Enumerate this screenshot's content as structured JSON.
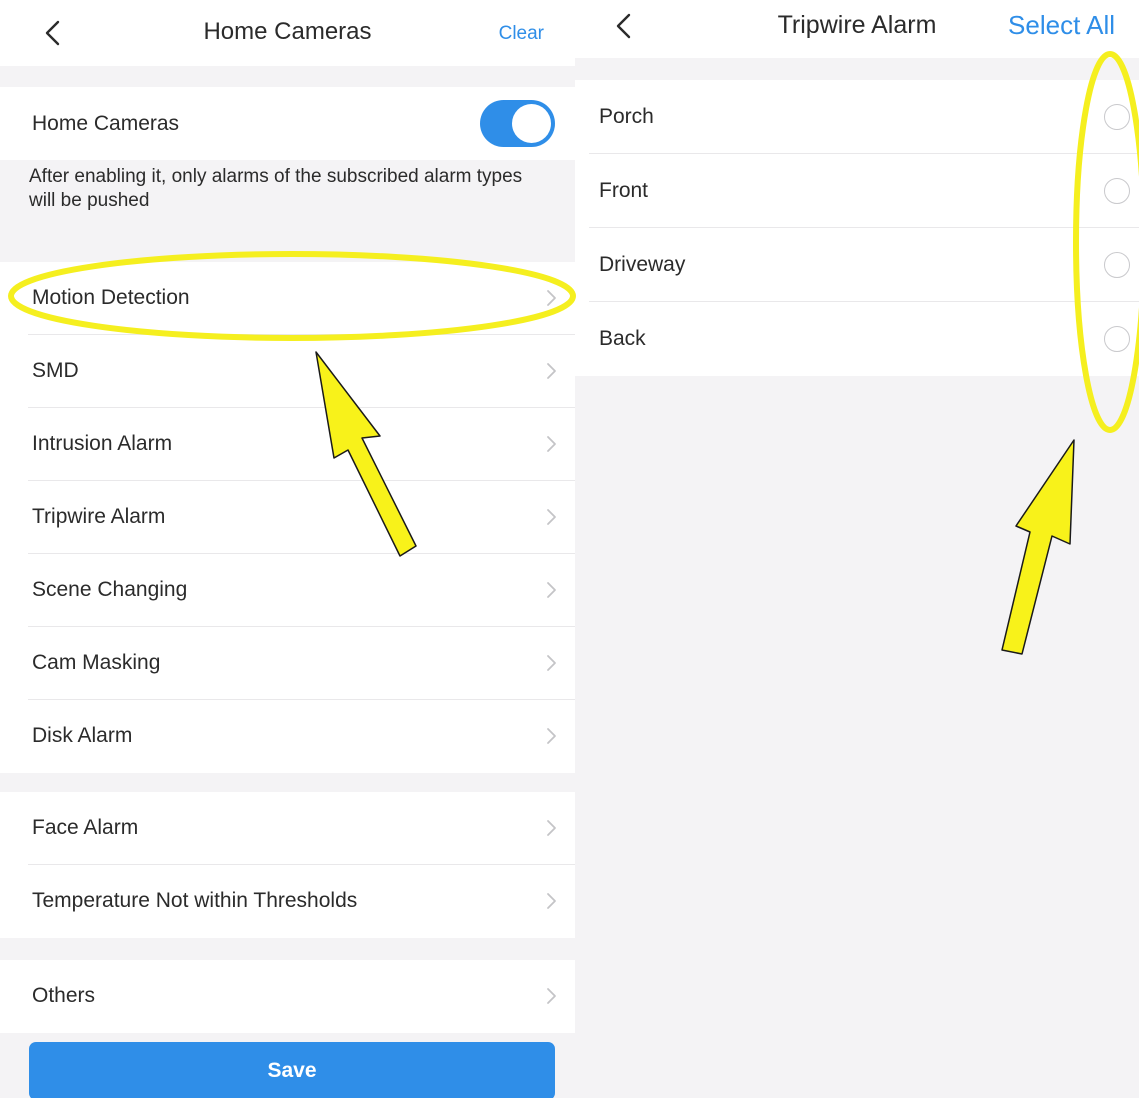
{
  "left": {
    "header": {
      "title": "Home Cameras",
      "action": "Clear"
    },
    "toggle": {
      "label": "Home Cameras",
      "on": true
    },
    "helper_text": "After enabling it, only alarms of the subscribed alarm types will be pushed",
    "group1": [
      {
        "label": "Motion Detection"
      },
      {
        "label": "SMD"
      },
      {
        "label": "Intrusion Alarm"
      },
      {
        "label": "Tripwire Alarm"
      },
      {
        "label": "Scene Changing"
      },
      {
        "label": "Cam Masking"
      },
      {
        "label": "Disk Alarm"
      }
    ],
    "group2": [
      {
        "label": "Face Alarm"
      },
      {
        "label": "Temperature Not within Thresholds"
      }
    ],
    "group3": [
      {
        "label": "Others"
      }
    ],
    "save_label": "Save"
  },
  "right": {
    "header": {
      "title": "Tripwire Alarm",
      "action": "Select All"
    },
    "channels": [
      {
        "label": "Porch",
        "selected": false
      },
      {
        "label": "Front",
        "selected": false
      },
      {
        "label": "Driveway",
        "selected": false
      },
      {
        "label": "Back",
        "selected": false
      }
    ]
  },
  "colors": {
    "accent": "#2f8ee8",
    "highlight": "#f5ef1f",
    "background": "#f4f3f5",
    "text": "#2b2b2b"
  },
  "icons": {
    "back": "chevron-left-icon",
    "row": "chevron-right-icon",
    "radio": "radio-circle-icon"
  }
}
